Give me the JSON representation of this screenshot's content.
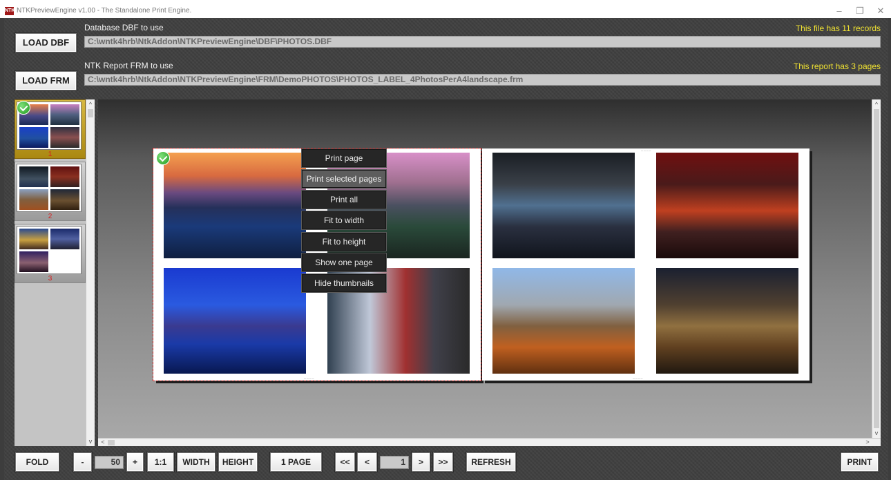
{
  "window": {
    "icon_text": "NTK",
    "title": "NTKPreviewEngine v1.00 - The Standalone Print Engine."
  },
  "dbf": {
    "button_label": "LOAD DBF",
    "label": "Database DBF to use",
    "path": "C:\\wntk4hrb\\NtkAddon\\NTKPreviewEngine\\DBF\\PHOTOS.DBF",
    "info": "This file has 11 records"
  },
  "frm": {
    "button_label": "LOAD FRM",
    "label": "NTK Report FRM to use",
    "path": "C:\\wntk4hrb\\NtkAddon\\NTKPreviewEngine\\FRM\\DemoPHOTOS\\PHOTOS_LABEL_4PhotosPerA4landscape.frm",
    "info": "This report has 3 pages"
  },
  "thumbnails": [
    {
      "number": "1",
      "selected": true
    },
    {
      "number": "2",
      "selected": false
    },
    {
      "number": "3",
      "selected": false
    }
  ],
  "context_menu": [
    {
      "label": "Print page"
    },
    {
      "label": "Print selected pages",
      "hover": true
    },
    {
      "label": "Print all"
    },
    {
      "label": "Fit to width"
    },
    {
      "label": "Fit to height"
    },
    {
      "label": "Show one page"
    },
    {
      "label": "Hide thumbnails"
    }
  ],
  "scrollbar_glyphs": {
    "up": "^",
    "down": "v",
    "left": "<",
    "right": ">"
  },
  "toolbar": {
    "fold": "FOLD",
    "zoom_out": "-",
    "zoom_value": "50",
    "zoom_in": "+",
    "one_to_one": "1:1",
    "width": "WIDTH",
    "height": "HEIGHT",
    "one_page": "1 PAGE",
    "first": "<<",
    "prev": "<",
    "page_value": "1",
    "next": ">",
    "last": ">>",
    "refresh": "REFRESH",
    "print": "PRINT"
  },
  "colors": {
    "info_text": "#f0e232",
    "selected_thumb": "#c9a42a",
    "thumb_number": "#d81c1c",
    "menu_bg": "#262626",
    "menu_hover": "#5d5d5d"
  }
}
